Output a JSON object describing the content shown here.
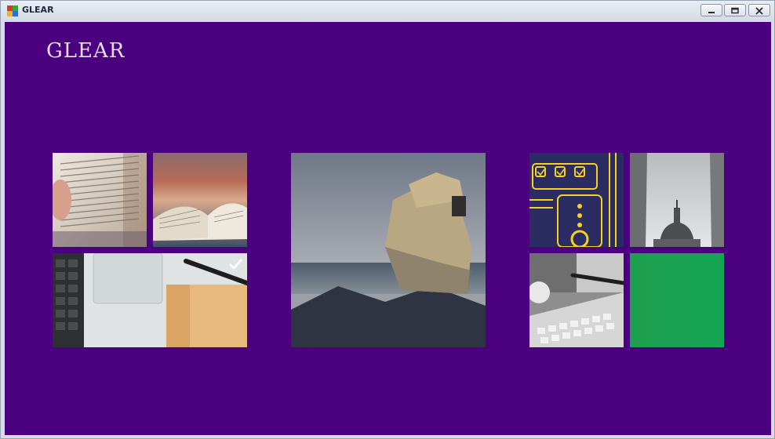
{
  "window": {
    "title": "GLEAR",
    "controls": {
      "minimize": "minimize-icon",
      "maximize": "maximize-icon",
      "close": "close-icon"
    }
  },
  "app": {
    "brand": "GLEAR",
    "background_color": "#4b0080",
    "tile_groups": [
      {
        "name": "group-1",
        "tiles": [
          "open-book-closeup",
          "open-book-table",
          "laptop-notebook"
        ],
        "selected": "laptop-notebook"
      },
      {
        "name": "group-2",
        "tiles": [
          "ruined-tower-beach"
        ]
      },
      {
        "name": "group-3",
        "tiles": [
          "security-illustration",
          "dome-skyline",
          "keyboard-desk",
          "green-tile"
        ]
      }
    ],
    "accent_green": "#1e9e50"
  }
}
